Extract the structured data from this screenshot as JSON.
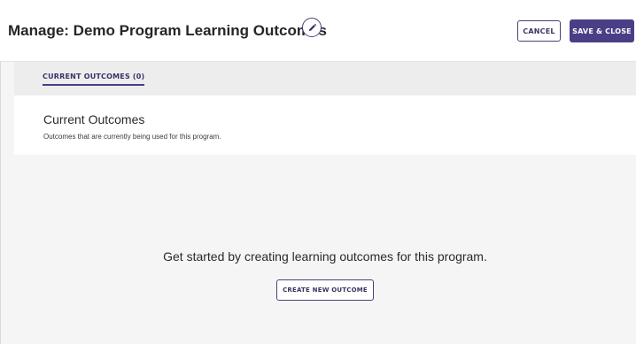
{
  "header": {
    "title": "Manage: Demo Program Learning Outcomes",
    "edit_icon": "pencil-icon",
    "cancel_label": "CANCEL",
    "save_label": "SAVE & CLOSE"
  },
  "tabs": [
    {
      "label": "CURRENT OUTCOMES (0)",
      "active": true
    }
  ],
  "section": {
    "title": "Current Outcomes",
    "description": "Outcomes that are currently being used for this program."
  },
  "empty_state": {
    "message": "Get started by creating learning outcomes for this program.",
    "button_label": "CREATE NEW OUTCOME"
  },
  "colors": {
    "accent": "#4a3f86",
    "background": "#f5f5f5",
    "tabbar": "#ededed"
  }
}
